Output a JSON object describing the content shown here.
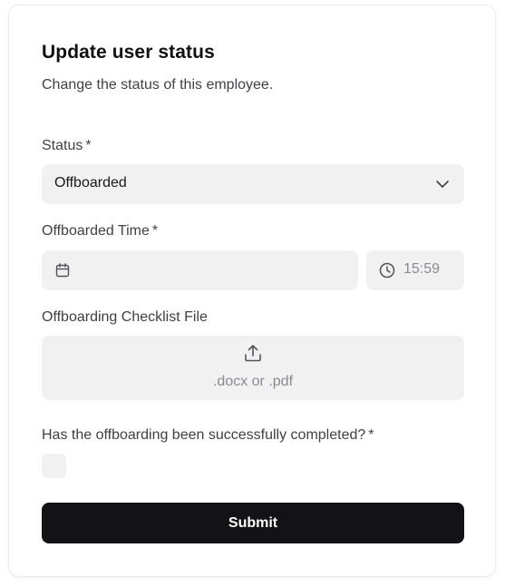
{
  "form": {
    "title": "Update user status",
    "subtitle": "Change the status of this employee.",
    "status": {
      "label": "Status",
      "required_mark": "*",
      "value": "Offboarded"
    },
    "offboarded_time": {
      "label": "Offboarded Time",
      "required_mark": "*",
      "date_value": "",
      "time_value": "15:59"
    },
    "checklist_file": {
      "label": "Offboarding Checklist File",
      "hint": ".docx or .pdf"
    },
    "completed": {
      "label": "Has the offboarding been successfully completed?",
      "required_mark": "*",
      "checked": false
    },
    "submit_label": "Submit"
  },
  "icons": {
    "chevron": "chevron-down-icon",
    "calendar": "calendar-icon",
    "clock": "clock-icon",
    "upload": "upload-icon"
  },
  "colors": {
    "field_bg": "#f1f1f1",
    "primary_button": "#131316",
    "muted_text": "#8a8a92"
  }
}
